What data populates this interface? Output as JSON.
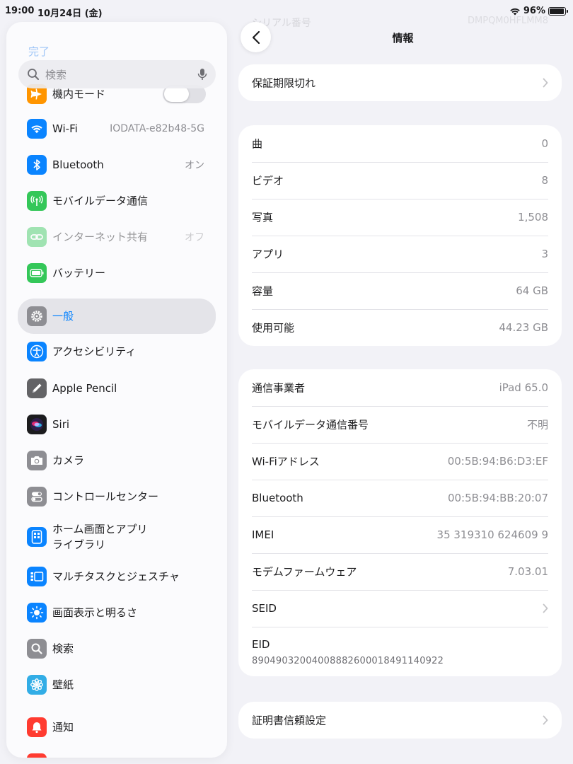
{
  "status": {
    "time": "19:00",
    "date": "10月24日 (金)",
    "battery": "96%",
    "battery_level": 0.96
  },
  "sidebar": {
    "done": "完了",
    "search_placeholder": "検索",
    "items": [
      {
        "label": "機内モード",
        "icon": "airplane-icon",
        "color": "#ff9500"
      },
      {
        "label": "Wi-Fi",
        "value": "IODATA-e82b48-5G",
        "icon": "wifi-icon",
        "color": "#0a84ff"
      },
      {
        "label": "Bluetooth",
        "value": "オン",
        "icon": "bluetooth-icon",
        "color": "#0a84ff"
      },
      {
        "label": "モバイルデータ通信",
        "icon": "antenna-icon",
        "color": "#34c759"
      },
      {
        "label": "インターネット共有",
        "value": "オフ",
        "icon": "chain-icon",
        "color": "#34c759"
      },
      {
        "label": "バッテリー",
        "icon": "battery-icon",
        "color": "#34c759"
      },
      {
        "label": "一般",
        "icon": "gear-icon",
        "color": "#8e8e93"
      },
      {
        "label": "アクセシビリティ",
        "icon": "accessibility-icon",
        "color": "#0a84ff"
      },
      {
        "label": "Apple Pencil",
        "icon": "pencil-icon",
        "color": "#636366"
      },
      {
        "label": "Siri",
        "icon": "siri-icon",
        "color": "#1c1c1e"
      },
      {
        "label": "カメラ",
        "icon": "camera-icon",
        "color": "#8e8e93"
      },
      {
        "label": "コントロールセンター",
        "icon": "switches-icon",
        "color": "#8e8e93"
      },
      {
        "label": "ホーム画面とアプリ",
        "label2": "ライブラリ",
        "icon": "home-screen-icon",
        "color": "#0a84ff"
      },
      {
        "label": "マルチタスクとジェスチャ",
        "icon": "multitask-icon",
        "color": "#0a84ff"
      },
      {
        "label": "画面表示と明るさ",
        "icon": "sun-icon",
        "color": "#0a84ff"
      },
      {
        "label": "検索",
        "icon": "search-icon",
        "color": "#8e8e93"
      },
      {
        "label": "壁紙",
        "icon": "flower-icon",
        "color": "#32ade6"
      },
      {
        "label": "通知",
        "icon": "bell-icon",
        "color": "#ff3b30"
      }
    ]
  },
  "main": {
    "title": "情報",
    "ghost_label": "シリアル番号",
    "ghost_value": "DMPQM0HFLMM8",
    "warranty": "保証期限切れ",
    "media": [
      {
        "label": "曲",
        "value": "0"
      },
      {
        "label": "ビデオ",
        "value": "8"
      },
      {
        "label": "写真",
        "value": "1,508"
      },
      {
        "label": "アプリ",
        "value": "3"
      },
      {
        "label": "容量",
        "value": "64 GB"
      },
      {
        "label": "使用可能",
        "value": "44.23 GB"
      }
    ],
    "network": [
      {
        "label": "通信事業者",
        "value": "iPad 65.0"
      },
      {
        "label": "モバイルデータ通信番号",
        "value": "不明"
      },
      {
        "label": "Wi-Fiアドレス",
        "value": "00:5B:94:B6:D3:EF"
      },
      {
        "label": "Bluetooth",
        "value": "00:5B:94:BB:20:07"
      },
      {
        "label": "IMEI",
        "value": "35 319310 624609 9"
      },
      {
        "label": "モデムファームウェア",
        "value": "7.03.01"
      },
      {
        "label": "SEID",
        "value": ""
      },
      {
        "label": "EID",
        "value": "89049032004008882600018491140922"
      }
    ],
    "cert": "証明書信頼設定"
  }
}
